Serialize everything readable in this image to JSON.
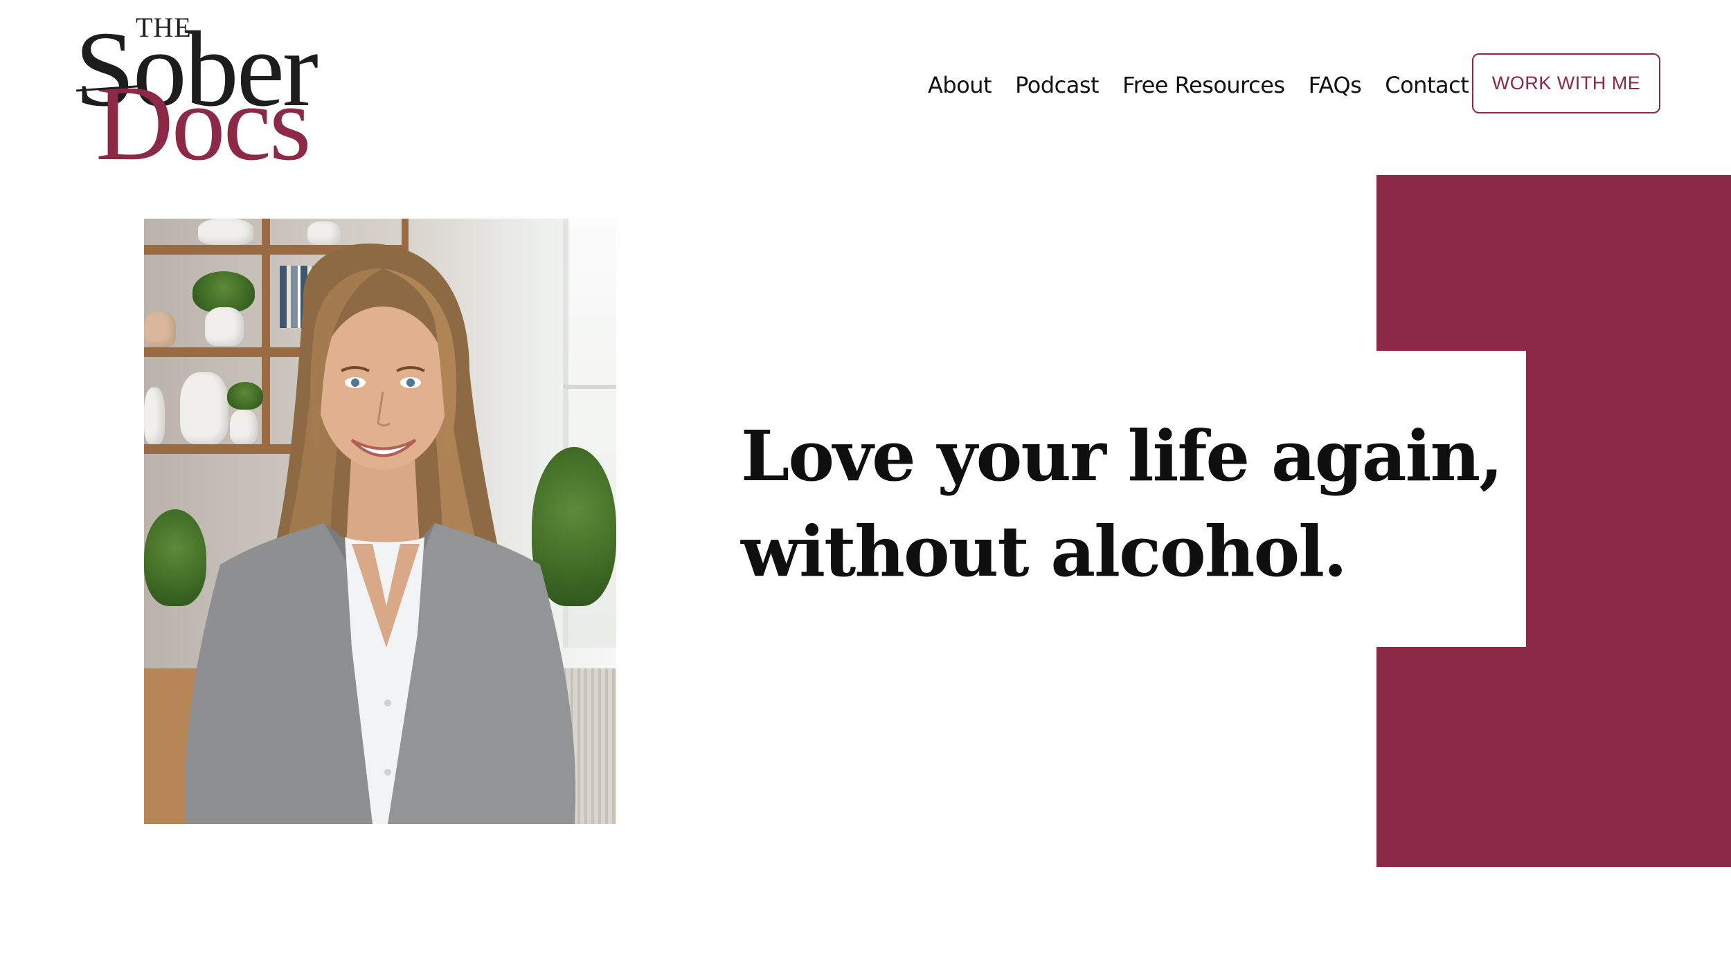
{
  "brand": {
    "logo_the": "THE",
    "logo_sober": "Sober",
    "logo_docs": "Docs",
    "accent_color": "#8b2946"
  },
  "nav": {
    "items": [
      {
        "label": "About"
      },
      {
        "label": "Podcast"
      },
      {
        "label": "Free Resources"
      },
      {
        "label": "FAQs"
      },
      {
        "label": "Contact"
      }
    ],
    "cta_label": "WORK WITH ME"
  },
  "hero": {
    "headline_line1": "Love your life again,",
    "headline_line2": "without alcohol."
  }
}
